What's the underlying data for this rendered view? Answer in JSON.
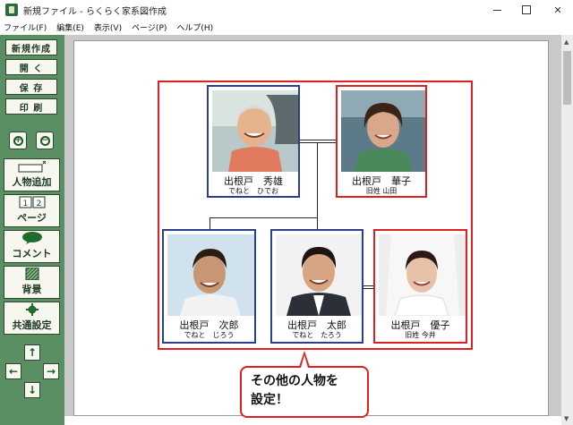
{
  "window": {
    "title": "新規ファイル - らくらく家系図作成",
    "controls": [
      "minimize",
      "maximize",
      "close"
    ]
  },
  "menu": [
    "ファイル(F)",
    "編集(E)",
    "表示(V)",
    "ページ(P)",
    "ヘルプ(H)"
  ],
  "toolbar": {
    "new": "新規作成",
    "open": "開 く",
    "save": "保 存",
    "print": "印 刷",
    "add_person": "人物追加",
    "page": "ページ",
    "page_icon": [
      "1",
      "2"
    ],
    "comment": "コメント",
    "background": "背景",
    "common_settings": "共通設定"
  },
  "persons": [
    {
      "id": "hideo",
      "name": "出根戸　秀雄",
      "reading": "でねと　ひでお",
      "gender": "male"
    },
    {
      "id": "hanako",
      "name": "出根戸　華子",
      "reading": "旧姓 山田",
      "gender": "female"
    },
    {
      "id": "jiro",
      "name": "出根戸　次郎",
      "reading": "でねと　じろう",
      "gender": "male"
    },
    {
      "id": "taro",
      "name": "出根戸　太郎",
      "reading": "でねと　たろう",
      "gender": "male"
    },
    {
      "id": "yuko",
      "name": "出根戸　優子",
      "reading": "旧姓 今井",
      "gender": "female"
    }
  ],
  "callout": {
    "line1": "その他の人物を",
    "line2": "設定！"
  },
  "colors": {
    "toolbar_bg": "#5a8f64",
    "male_border": "#2a3f8f",
    "female_border": "#e02020",
    "highlight_border": "#e02020",
    "workspace_bg": "#c9c9c9"
  }
}
